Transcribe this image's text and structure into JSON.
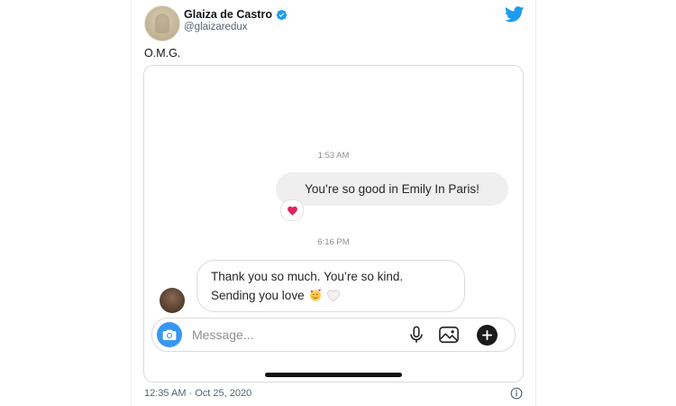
{
  "tweet": {
    "author_name": "Glaiza de Castro",
    "handle": "@glaizaredux",
    "text": "O.M.G.",
    "posted_at": "12:35 AM · Oct 25, 2020",
    "icons": {
      "verified": "verified-badge-icon",
      "brand": "twitter-bird-icon",
      "info": "info-icon"
    }
  },
  "screenshot": {
    "timestamp_1": "1:53 AM",
    "outgoing_message": "You’re so good in Emily In Paris!",
    "reaction": "❤️",
    "timestamp_2": "6:16 PM",
    "incoming_line1": "Thank you so much. You’re so kind.",
    "incoming_line2": "Sending you love",
    "composer": {
      "placeholder": "Message...",
      "icons": [
        "camera-icon",
        "microphone-icon",
        "gallery-icon",
        "plus-icon"
      ]
    }
  },
  "colors": {
    "verified_blue": "#1d9bf0",
    "twitter_blue": "#1d9bf0",
    "camera_blue": "#3797f0",
    "bubble_gray": "#efefef",
    "reaction_red": "#e0245e"
  }
}
